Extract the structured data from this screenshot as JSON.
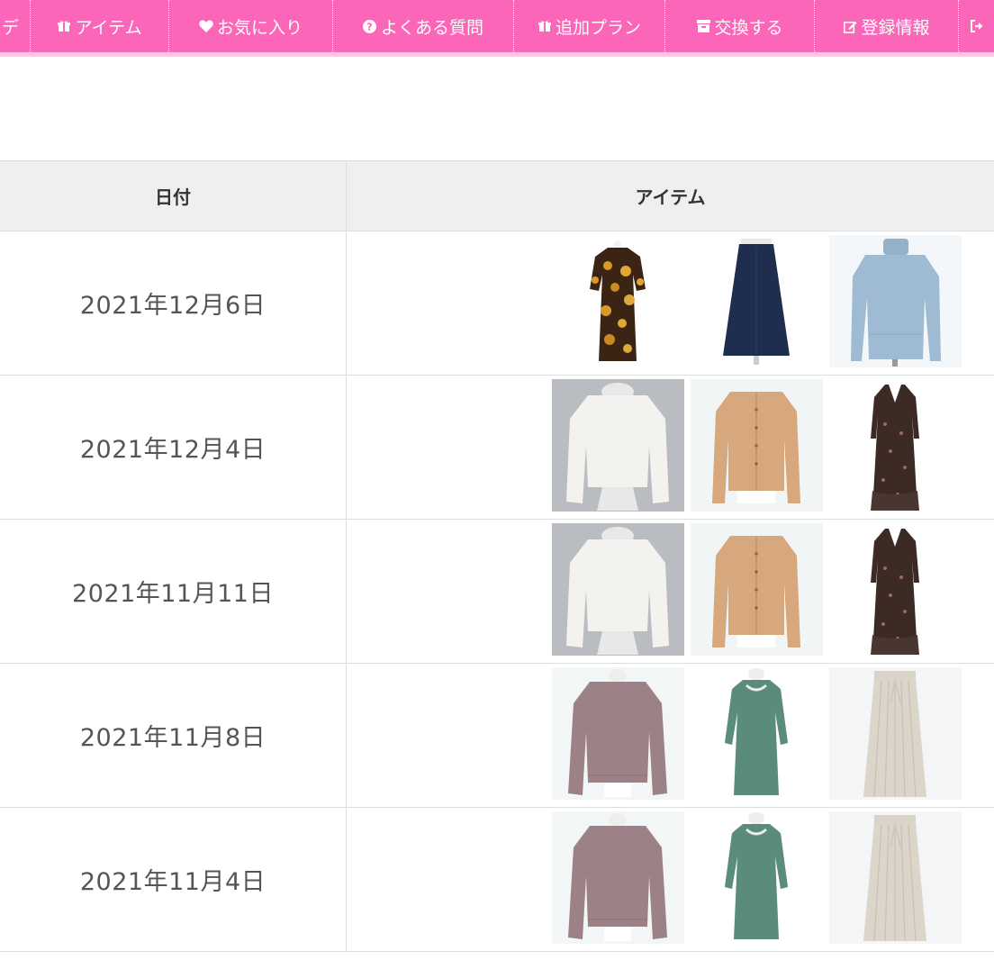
{
  "nav": {
    "items": [
      {
        "label": "デ",
        "icon": "none"
      },
      {
        "label": "アイテム",
        "icon": "gift-icon"
      },
      {
        "label": "お気に入り",
        "icon": "heart-icon"
      },
      {
        "label": "よくある質問",
        "icon": "question-icon"
      },
      {
        "label": "追加プラン",
        "icon": "gift-icon"
      },
      {
        "label": "交換する",
        "icon": "archive-icon"
      },
      {
        "label": "登録情報",
        "icon": "edit-icon"
      },
      {
        "label": "",
        "icon": "sign-out-icon"
      }
    ]
  },
  "table": {
    "headers": {
      "date": "日付",
      "items": "アイテム"
    },
    "rows": [
      {
        "date": "2021年12月6日",
        "items": [
          "floral-print-dress",
          "navy-skirt",
          "light-blue-turtleneck-sweater"
        ]
      },
      {
        "date": "2021年12月4日",
        "items": [
          "white-knit-sweater",
          "camel-cardigan",
          "floral-print-long-dress"
        ]
      },
      {
        "date": "2021年11月11日",
        "items": [
          "white-knit-sweater",
          "camel-cardigan",
          "floral-print-long-dress"
        ]
      },
      {
        "date": "2021年11月8日",
        "items": [
          "mauve-sweater",
          "green-knit-dress",
          "beige-pleated-skirt"
        ]
      },
      {
        "date": "2021年11月4日",
        "items": [
          "mauve-sweater",
          "green-knit-dress",
          "beige-pleated-skirt"
        ]
      }
    ]
  },
  "colors": {
    "nav_bg": "#fc66b8",
    "nav_underline": "#ffc6e4",
    "header_bg": "#efefef",
    "border": "#dddddd",
    "text": "#555555"
  }
}
